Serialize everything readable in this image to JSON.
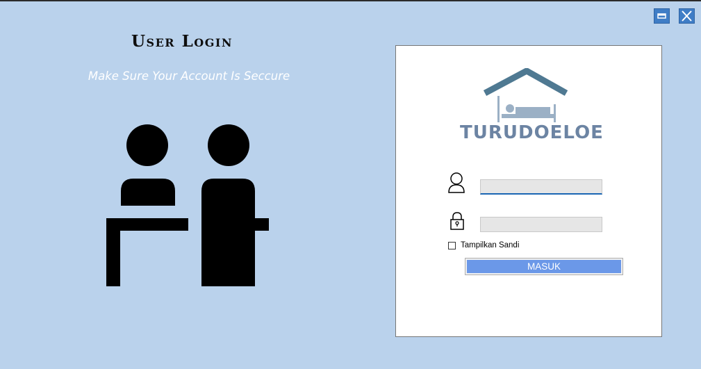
{
  "window": {
    "minimize_icon": "minimize-icon",
    "close_icon": "close-icon",
    "accent_color": "#3f7dc6"
  },
  "header": {
    "title": "User Login",
    "subtitle": "Make Sure Your Account Is Seccure"
  },
  "illustration": {
    "icon": "two-people-at-desk-icon"
  },
  "brand": {
    "name": "TURUDOELOE",
    "logo_icon": "house-bed-logo"
  },
  "form": {
    "username": {
      "icon": "user-icon",
      "value": "",
      "placeholder": ""
    },
    "password": {
      "icon": "lock-icon",
      "value": "",
      "placeholder": ""
    },
    "show_password_label": "Tampilkan Sandi",
    "show_password_checked": false,
    "submit_label": "MASUK",
    "submit_color": "#6b98e8"
  },
  "colors": {
    "background": "#bad2ec",
    "panel": "#ffffff"
  }
}
